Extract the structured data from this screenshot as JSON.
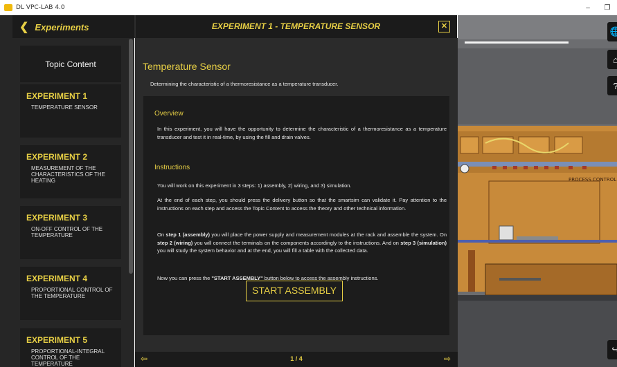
{
  "window": {
    "title": "DL VPC-LAB 4.0",
    "minimize_glyph": "–",
    "restore_glyph": "❐"
  },
  "header": {
    "back_label": "Experiments",
    "experiment_title": "EXPERIMENT 1 - TEMPERATURE SENSOR",
    "close_glyph": "✕"
  },
  "sidebar": {
    "topic_content": "Topic Content",
    "experiments": [
      {
        "number": "EXPERIMENT 1",
        "name": "TEMPERATURE SENSOR"
      },
      {
        "number": "EXPERIMENT 2",
        "name": "MEASUREMENT OF THE CHARACTERISTICS OF THE HEATING"
      },
      {
        "number": "EXPERIMENT 3",
        "name": "ON-OFF CONTROL OF THE TEMPERATURE"
      },
      {
        "number": "EXPERIMENT 4",
        "name": "PROPORTIONAL CONTROL OF THE TEMPERATURE"
      },
      {
        "number": "EXPERIMENT 5",
        "name": "PROPORTIONAL-INTEGRAL CONTROL OF THE TEMPERATURE"
      }
    ]
  },
  "main": {
    "heading": "Temperature Sensor",
    "subtitle": "Determining the characteristic of a thermoresistance as a temperature transducer.",
    "overview_title": "Overview",
    "overview_text": "In this experiment, you will have the opportunity to determine the characteristic of a thermoresistance as a temperature transducer and test it in real-time, by using the fill and drain valves.",
    "instructions_title": "Instructions",
    "instructions_1": "You will work on this experiment in 3 steps: 1) assembly, 2) wiring, and 3) simulation.",
    "instructions_2": "At the end of each step, you should press the delivery button so that the smartsim can validate it. Pay attention to the instructions on each step and access the Topic Content to access the theory and other technical information.",
    "instructions_3_parts": {
      "a": "On ",
      "b": "step 1 (assembly)",
      "c": " you will place the power supply and measurement modules at the rack and assemble the system. On ",
      "d": "step 2 (wiring)",
      "e": " you will connect the terminals on the components accordingly to the instructions. And on ",
      "f": "step 3 (simulation)",
      "g": " you will study the system behavior and at the end, you will fill a table with the collected data."
    },
    "instructions_4_parts": {
      "a": "Now you can press the ",
      "b": "\"START ASSEMBLY\"",
      "c": " button below to access the assembly instructions."
    },
    "start_button": "START ASSEMBLY"
  },
  "footer": {
    "prev_glyph": "⇦",
    "next_glyph": "⇨",
    "page": "1 / 4"
  },
  "scene": {
    "panel_text": "PROCESS CONTROL",
    "tools": [
      "globe-icon",
      "home-icon",
      "help-icon",
      "exit-icon"
    ]
  },
  "colors": {
    "accent": "#e7cf45",
    "panel_bg": "#2b2b2b",
    "card_bg": "#1c1c1c",
    "board_orange": "#c88a3a"
  }
}
